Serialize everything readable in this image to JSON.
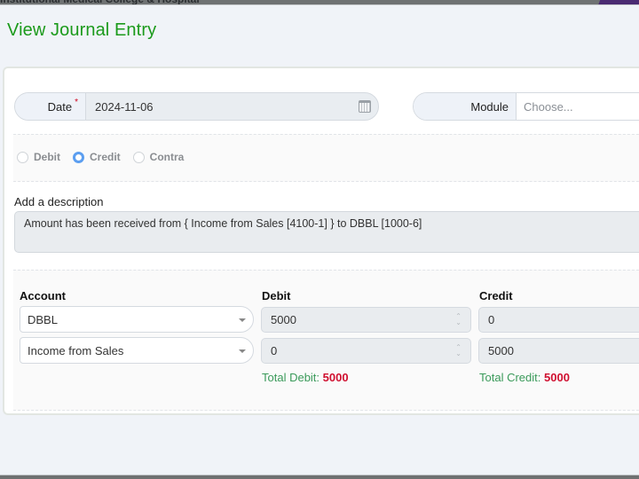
{
  "topbar": {
    "org_name": "Institutional Medical College & Hospital"
  },
  "page": {
    "title": "View Journal Entry"
  },
  "form": {
    "date": {
      "label": "Date",
      "required_mark": "*",
      "value": "2024-11-06",
      "icon": "calendar-icon"
    },
    "module": {
      "label": "Module",
      "placeholder": "Choose..."
    },
    "entry_type": {
      "options": [
        {
          "label": "Debit",
          "checked": false
        },
        {
          "label": "Credit",
          "checked": true
        },
        {
          "label": "Contra",
          "checked": false
        }
      ]
    },
    "description": {
      "label": "Add a description",
      "value": "Amount has been received from { Income from Sales [4100-1] } to DBBL [1000-6]"
    }
  },
  "entries": {
    "headers": {
      "account": "Account",
      "debit": "Debit",
      "credit": "Credit"
    },
    "rows": [
      {
        "account": "DBBL",
        "debit": "5000",
        "credit": "0"
      },
      {
        "account": "Income from Sales",
        "debit": "0",
        "credit": "5000"
      }
    ],
    "totals": {
      "debit_label": "Total Debit:",
      "debit_value": "5000",
      "credit_label": "Total Credit:",
      "credit_value": "5000"
    }
  },
  "colors": {
    "title_green": "#1b9a1b",
    "total_label_green": "#3a9a5a",
    "total_value_red": "#d01030",
    "radio_accent": "#5b9ef0",
    "header_accent_purple": "#4a2a72"
  }
}
